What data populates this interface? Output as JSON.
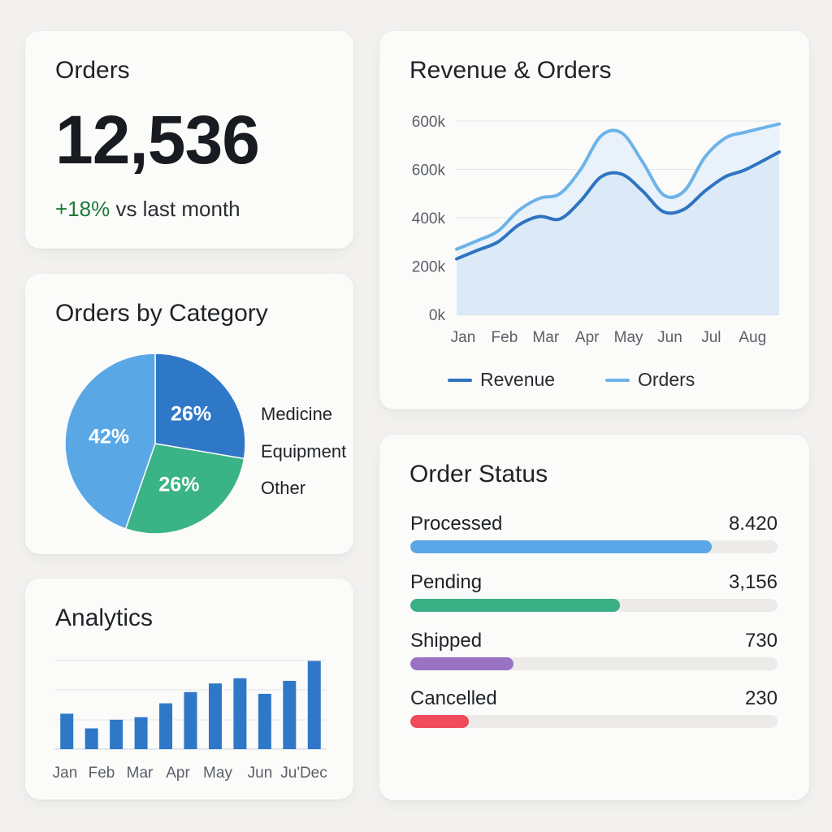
{
  "orders_card": {
    "title": "Orders",
    "value": "12,536",
    "change": "+18%",
    "change_suffix": " vs last month",
    "change_color": "#1f7a3a"
  },
  "revenue_card": {
    "title": "Revenue & Orders",
    "legend": [
      {
        "label": "Revenue",
        "color": "#2f74c0"
      },
      {
        "label": "Orders",
        "color": "#6db3e8"
      }
    ]
  },
  "category_card": {
    "title": "Orders by Category",
    "legend": [
      "Medicine",
      "Equipment",
      "Other"
    ]
  },
  "status_card": {
    "title": "Order Status",
    "rows": [
      {
        "label": "Processed",
        "value": "8.420",
        "fraction": 0.82,
        "color": "#5ba6e6"
      },
      {
        "label": "Pending",
        "value": "3,156",
        "fraction": 0.57,
        "color": "#3aae84"
      },
      {
        "label": "Shipped",
        "value": "730",
        "fraction": 0.28,
        "color": "#9a72c4"
      },
      {
        "label": "Cancelled",
        "value": "230",
        "fraction": 0.16,
        "color": "#f04b5a"
      }
    ]
  },
  "analytics_card": {
    "title": "Analytics"
  },
  "chart_data": [
    {
      "type": "area",
      "title": "Revenue & Orders",
      "categories": [
        "Jan",
        "Feb",
        "Mar",
        "Apr",
        "May",
        "Jun",
        "Jul",
        "Aug"
      ],
      "y_tick_labels": [
        "0k",
        "200k",
        "400k",
        "600k",
        "600k"
      ],
      "ylim": [
        0,
        800
      ],
      "grid": true,
      "legend_position": "bottom",
      "series": [
        {
          "name": "Revenue",
          "color": "#2f74c0",
          "x": [
            0,
            0.5,
            1,
            1.5,
            2,
            2.5,
            3,
            3.5,
            4,
            4.5,
            5,
            5.5,
            6,
            6.5,
            7,
            7.8
          ],
          "values": [
            230,
            265,
            300,
            370,
            405,
            395,
            470,
            570,
            580,
            510,
            425,
            435,
            510,
            570,
            600,
            672
          ]
        },
        {
          "name": "Orders",
          "color": "#6db3e8",
          "x": [
            0,
            0.5,
            1,
            1.5,
            2,
            2.5,
            3,
            3.5,
            4,
            4.5,
            5,
            5.5,
            6,
            6.5,
            7,
            7.8
          ],
          "values": [
            270,
            305,
            345,
            430,
            480,
            500,
            600,
            740,
            750,
            630,
            495,
            510,
            650,
            730,
            755,
            788
          ]
        }
      ]
    },
    {
      "type": "pie",
      "title": "Orders by Category",
      "slices": [
        {
          "label": "26%",
          "value": 26,
          "color": "#2f78c8"
        },
        {
          "label": "26%",
          "value": 26,
          "color": "#3ab386"
        },
        {
          "label": "42%",
          "value": 42,
          "color": "#5aa7e6"
        }
      ],
      "legend": [
        "Medicine",
        "Equipment",
        "Other"
      ],
      "legend_position": "right"
    },
    {
      "type": "bar",
      "title": "Analytics",
      "categories": [
        "Jan",
        "Feb",
        "Mar",
        "Apr",
        "May",
        "Jun",
        "Ju'Dec"
      ],
      "values": [
        41,
        24,
        34,
        37,
        53,
        66,
        76,
        82,
        64,
        79,
        102
      ],
      "ylim": [
        0,
        110
      ],
      "grid": true,
      "color": "#2f78c8"
    }
  ]
}
